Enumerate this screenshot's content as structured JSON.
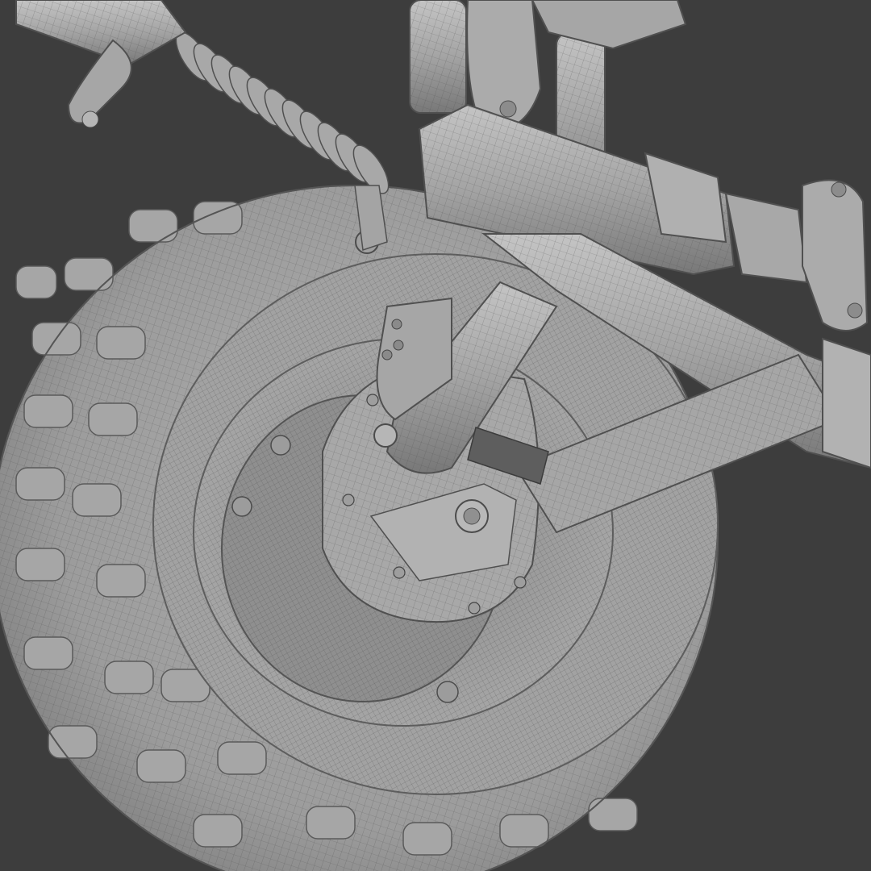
{
  "scene": {
    "background_color": "#3d3d3d",
    "mesh_fill_color": "#9a9a9a",
    "mesh_light_color": "#b4b4b4",
    "mesh_shadow_color": "#6e6e6e",
    "wire_color": "#4a4a4a",
    "object_names": [
      "tire",
      "wheel-hub",
      "brake-assembly",
      "coil-spring",
      "lower-control-arm",
      "upper-control-arm",
      "steering-knuckle",
      "shock-absorber"
    ]
  }
}
